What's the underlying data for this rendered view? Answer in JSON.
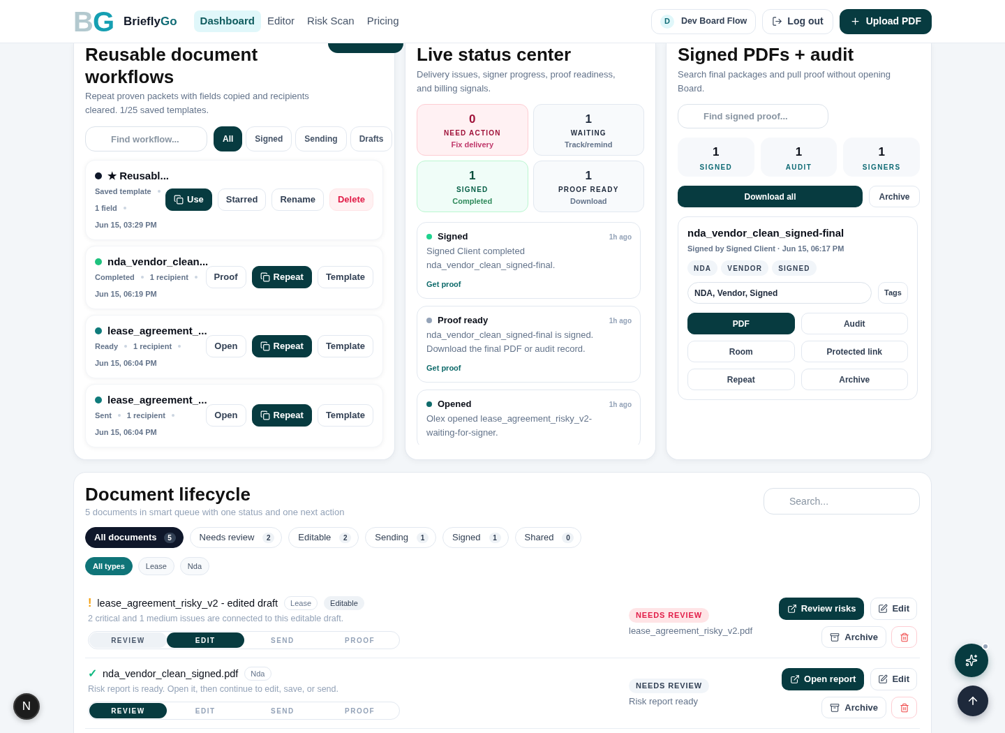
{
  "header": {
    "brand": {
      "mark": "BG",
      "name": "Briefly",
      "name_accent": "Go"
    },
    "nav": [
      {
        "label": "Dashboard",
        "selected": true
      },
      {
        "label": "Editor",
        "selected": false
      },
      {
        "label": "Risk Scan",
        "selected": false
      },
      {
        "label": "Pricing",
        "selected": false
      }
    ],
    "workspace": {
      "initial": "D",
      "label": "Dev Board Flow"
    },
    "logout": "Log out",
    "upload": "Upload PDF"
  },
  "workflows": {
    "title": "Reusable document workflows",
    "description": "Repeat proven packets with fields copied and recipients cleared. 1/25 saved templates.",
    "search_placeholder": "Find workflow...",
    "filters": [
      {
        "label": "All",
        "selected": true
      },
      {
        "label": "Signed",
        "selected": false
      },
      {
        "label": "Sending",
        "selected": false
      },
      {
        "label": "Drafts",
        "selected": false
      }
    ],
    "items": [
      {
        "title": "★ Reusabl...",
        "color": "#0f172a",
        "meta": [
          "Saved template",
          "1 field",
          "Jun 15, 03:29 PM"
        ],
        "actions": [
          {
            "label": "Use",
            "kind": "primary"
          },
          {
            "label": "Starred",
            "kind": "outline"
          },
          {
            "label": "Rename",
            "kind": "outline"
          },
          {
            "label": "Delete",
            "kind": "danger"
          }
        ]
      },
      {
        "title": "nda_vendor_clean...",
        "color": "#1ec27e",
        "meta": [
          "Completed",
          "1 recipient",
          "Jun 15, 06:19 PM"
        ],
        "actions": [
          {
            "label": "Proof",
            "kind": "outline"
          },
          {
            "label": "Repeat",
            "kind": "primary"
          },
          {
            "label": "Template",
            "kind": "outline"
          }
        ]
      },
      {
        "title": "lease_agreement_...",
        "color": "#0f7b7b",
        "meta": [
          "Ready",
          "1 recipient",
          "Jun 15, 06:04 PM"
        ],
        "actions": [
          {
            "label": "Open",
            "kind": "outline"
          },
          {
            "label": "Repeat",
            "kind": "primary"
          },
          {
            "label": "Template",
            "kind": "outline"
          }
        ]
      },
      {
        "title": "lease_agreement_...",
        "color": "#0f7b7b",
        "meta": [
          "Sent",
          "1 recipient",
          "Jun 15, 06:04 PM"
        ],
        "actions": [
          {
            "label": "Open",
            "kind": "outline"
          },
          {
            "label": "Repeat",
            "kind": "primary"
          },
          {
            "label": "Template",
            "kind": "outline"
          }
        ]
      }
    ]
  },
  "status_center": {
    "title": "Live status center",
    "description": "Delivery issues, signer progress, proof readiness, and billing signals.",
    "stats": [
      {
        "value": "0",
        "label": "NEED ACTION",
        "sub": "Fix delivery",
        "kind": "danger"
      },
      {
        "value": "1",
        "label": "WAITING",
        "sub": "Track/remind",
        "kind": "neutral"
      },
      {
        "value": "1",
        "label": "SIGNED",
        "sub": "Completed",
        "kind": "success"
      },
      {
        "value": "1",
        "label": "PROOF READY",
        "sub": "Download",
        "kind": "neutral"
      }
    ],
    "events": [
      {
        "title": "Signed",
        "time": "1h ago",
        "color": "#1ed38e",
        "text": "Signed Client completed nda_vendor_clean_signed-final.",
        "link": "Get proof"
      },
      {
        "title": "Proof ready",
        "time": "1h ago",
        "color": "#94a3b8",
        "text": "nda_vendor_clean_signed-final is signed. Download the final PDF or audit record.",
        "link": "Get proof"
      },
      {
        "title": "Opened",
        "time": "1h ago",
        "color": "#0f6b6b",
        "text": "Olex opened lease_agreement_risky_v2-waiting-for-signer."
      }
    ]
  },
  "signed_pdfs": {
    "title": "Signed PDFs + audit",
    "description": "Search final packages and pull proof without opening Board.",
    "search_placeholder": "Find signed proof...",
    "stats": [
      {
        "value": "1",
        "label": "SIGNED"
      },
      {
        "value": "1",
        "label": "AUDIT"
      },
      {
        "value": "1",
        "label": "SIGNERS"
      }
    ],
    "download_all": "Download all",
    "archive": "Archive",
    "document": {
      "title": "nda_vendor_clean_signed-final",
      "subtitle": "Signed by Signed Client · Jun 15, 06:17 PM",
      "tags": [
        "NDA",
        "VENDOR",
        "SIGNED"
      ],
      "tags_value": "NDA, Vendor, Signed",
      "tags_button": "Tags",
      "actions": [
        {
          "label": "PDF",
          "kind": "primary"
        },
        {
          "label": "Audit",
          "kind": "outline"
        },
        {
          "label": "Room",
          "kind": "outline"
        },
        {
          "label": "Protected link",
          "kind": "outline"
        },
        {
          "label": "Repeat",
          "kind": "outline"
        },
        {
          "label": "Archive",
          "kind": "outline"
        }
      ]
    }
  },
  "lifecycle": {
    "title": "Document lifecycle",
    "subtitle": "5 documents in smart queue with one status and one next action",
    "search_placeholder": "Search...",
    "tabs": [
      {
        "label": "All documents",
        "count": "5",
        "selected": true
      },
      {
        "label": "Needs review",
        "count": "2",
        "selected": false
      },
      {
        "label": "Editable",
        "count": "2",
        "selected": false
      },
      {
        "label": "Sending",
        "count": "1",
        "selected": false
      },
      {
        "label": "Signed",
        "count": "1",
        "selected": false
      },
      {
        "label": "Shared",
        "count": "0",
        "selected": false
      }
    ],
    "types": [
      {
        "label": "All types",
        "selected": true
      },
      {
        "label": "Lease",
        "selected": false
      },
      {
        "label": "Nda",
        "selected": false
      }
    ],
    "documents": [
      {
        "marker": {
          "symbol": "!",
          "kind": "warning"
        },
        "title": "lease_agreement_risky_v2 - edited draft",
        "tags": [
          {
            "label": "Lease",
            "kind": "outline"
          },
          {
            "label": "Editable",
            "kind": "filled"
          }
        ],
        "description": "2 critical and 1 medium issues are connected to this editable draft.",
        "steps": [
          {
            "label": "REVIEW",
            "done": true,
            "selected": false
          },
          {
            "label": "EDIT",
            "done": false,
            "selected": true
          },
          {
            "label": "SEND",
            "done": false,
            "selected": false
          },
          {
            "label": "PROOF",
            "done": false,
            "selected": false
          }
        ],
        "status": {
          "label": "NEEDS REVIEW",
          "kind": "danger"
        },
        "file": "lease_agreement_risky_v2.pdf",
        "primary_action": "Review risks",
        "edit": "Edit",
        "archive": "Archive"
      },
      {
        "marker": {
          "symbol": "✓",
          "kind": "ok"
        },
        "title": "nda_vendor_clean_signed.pdf",
        "tags": [
          {
            "label": "Nda",
            "kind": "outline"
          }
        ],
        "description": "Risk report is ready. Open it, then continue to edit, save, or send.",
        "steps": [
          {
            "label": "REVIEW",
            "done": false,
            "selected": true
          },
          {
            "label": "EDIT",
            "done": false,
            "selected": false
          },
          {
            "label": "SEND",
            "done": false,
            "selected": false
          },
          {
            "label": "PROOF",
            "done": false,
            "selected": false
          }
        ],
        "status": {
          "label": "NEEDS REVIEW",
          "kind": "neutral"
        },
        "file": "Risk report ready",
        "primary_action": "Open report",
        "edit": "Edit",
        "archive": "Archive"
      }
    ]
  },
  "floating": {
    "dev_indicator": "N"
  }
}
